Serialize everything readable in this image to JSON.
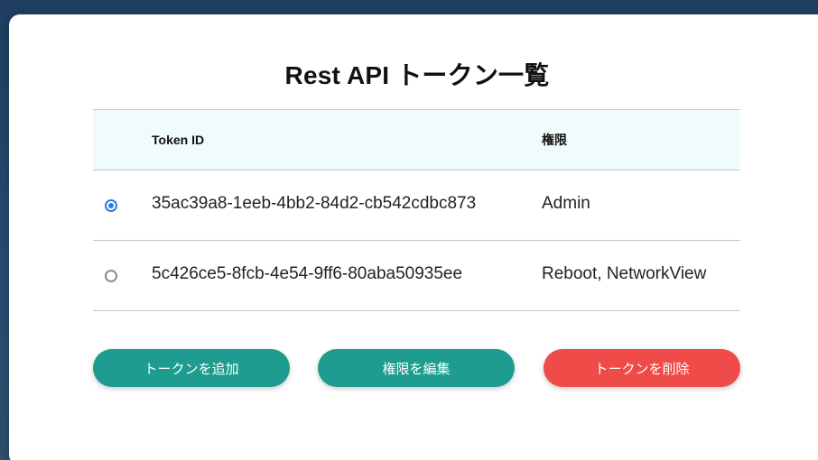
{
  "page": {
    "title": "Rest API トークン一覧"
  },
  "table": {
    "columns": [
      "Token ID",
      "権限"
    ],
    "rows": [
      {
        "token_id": "35ac39a8-1eeb-4bb2-84d2-cb542cdbc873",
        "permissions": "Admin",
        "selected": true
      },
      {
        "token_id": "5c426ce5-8fcb-4e54-9ff6-80aba50935ee",
        "permissions": "Reboot, NetworkView",
        "selected": false
      }
    ]
  },
  "actions": {
    "add_label": "トークンを追加",
    "edit_label": "権限を編集",
    "delete_label": "トークンを削除"
  },
  "colors": {
    "primary": "#1e9c8f",
    "danger": "#ef4b49",
    "header_bg": "#f0fbfb",
    "radio_selected": "#2a7de1"
  }
}
